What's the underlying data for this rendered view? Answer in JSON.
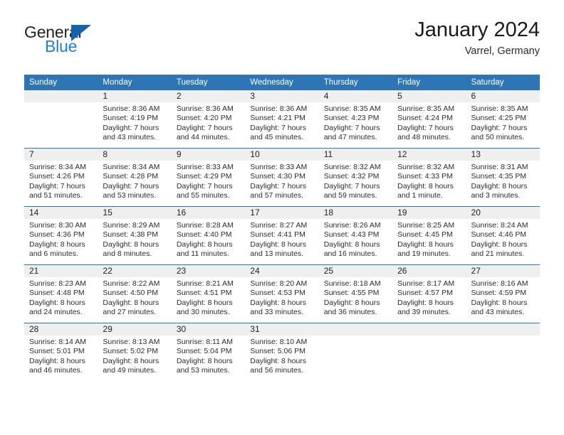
{
  "logo": {
    "word_top": "General",
    "word_bottom": "Blue",
    "triangle_icon": "triangle-icon",
    "color_dark": "#231f20",
    "color_blue": "#1f7fd4"
  },
  "header": {
    "title": "January 2024",
    "subtitle": "Varrel, Germany"
  },
  "theme": {
    "header_bg": "#2e75b6",
    "header_text": "#ffffff",
    "daynum_band_bg": "#efeff0",
    "row_rule": "#2e75b6"
  },
  "calendar": {
    "weekdays": [
      "Sunday",
      "Monday",
      "Tuesday",
      "Wednesday",
      "Thursday",
      "Friday",
      "Saturday"
    ],
    "weeks": [
      [
        {
          "day": "",
          "sunrise": "",
          "sunset": "",
          "daylight1": "",
          "daylight2": ""
        },
        {
          "day": "1",
          "sunrise": "Sunrise: 8:36 AM",
          "sunset": "Sunset: 4:19 PM",
          "daylight1": "Daylight: 7 hours",
          "daylight2": "and 43 minutes."
        },
        {
          "day": "2",
          "sunrise": "Sunrise: 8:36 AM",
          "sunset": "Sunset: 4:20 PM",
          "daylight1": "Daylight: 7 hours",
          "daylight2": "and 44 minutes."
        },
        {
          "day": "3",
          "sunrise": "Sunrise: 8:36 AM",
          "sunset": "Sunset: 4:21 PM",
          "daylight1": "Daylight: 7 hours",
          "daylight2": "and 45 minutes."
        },
        {
          "day": "4",
          "sunrise": "Sunrise: 8:35 AM",
          "sunset": "Sunset: 4:23 PM",
          "daylight1": "Daylight: 7 hours",
          "daylight2": "and 47 minutes."
        },
        {
          "day": "5",
          "sunrise": "Sunrise: 8:35 AM",
          "sunset": "Sunset: 4:24 PM",
          "daylight1": "Daylight: 7 hours",
          "daylight2": "and 48 minutes."
        },
        {
          "day": "6",
          "sunrise": "Sunrise: 8:35 AM",
          "sunset": "Sunset: 4:25 PM",
          "daylight1": "Daylight: 7 hours",
          "daylight2": "and 50 minutes."
        }
      ],
      [
        {
          "day": "7",
          "sunrise": "Sunrise: 8:34 AM",
          "sunset": "Sunset: 4:26 PM",
          "daylight1": "Daylight: 7 hours",
          "daylight2": "and 51 minutes."
        },
        {
          "day": "8",
          "sunrise": "Sunrise: 8:34 AM",
          "sunset": "Sunset: 4:28 PM",
          "daylight1": "Daylight: 7 hours",
          "daylight2": "and 53 minutes."
        },
        {
          "day": "9",
          "sunrise": "Sunrise: 8:33 AM",
          "sunset": "Sunset: 4:29 PM",
          "daylight1": "Daylight: 7 hours",
          "daylight2": "and 55 minutes."
        },
        {
          "day": "10",
          "sunrise": "Sunrise: 8:33 AM",
          "sunset": "Sunset: 4:30 PM",
          "daylight1": "Daylight: 7 hours",
          "daylight2": "and 57 minutes."
        },
        {
          "day": "11",
          "sunrise": "Sunrise: 8:32 AM",
          "sunset": "Sunset: 4:32 PM",
          "daylight1": "Daylight: 7 hours",
          "daylight2": "and 59 minutes."
        },
        {
          "day": "12",
          "sunrise": "Sunrise: 8:32 AM",
          "sunset": "Sunset: 4:33 PM",
          "daylight1": "Daylight: 8 hours",
          "daylight2": "and 1 minute."
        },
        {
          "day": "13",
          "sunrise": "Sunrise: 8:31 AM",
          "sunset": "Sunset: 4:35 PM",
          "daylight1": "Daylight: 8 hours",
          "daylight2": "and 3 minutes."
        }
      ],
      [
        {
          "day": "14",
          "sunrise": "Sunrise: 8:30 AM",
          "sunset": "Sunset: 4:36 PM",
          "daylight1": "Daylight: 8 hours",
          "daylight2": "and 6 minutes."
        },
        {
          "day": "15",
          "sunrise": "Sunrise: 8:29 AM",
          "sunset": "Sunset: 4:38 PM",
          "daylight1": "Daylight: 8 hours",
          "daylight2": "and 8 minutes."
        },
        {
          "day": "16",
          "sunrise": "Sunrise: 8:28 AM",
          "sunset": "Sunset: 4:40 PM",
          "daylight1": "Daylight: 8 hours",
          "daylight2": "and 11 minutes."
        },
        {
          "day": "17",
          "sunrise": "Sunrise: 8:27 AM",
          "sunset": "Sunset: 4:41 PM",
          "daylight1": "Daylight: 8 hours",
          "daylight2": "and 13 minutes."
        },
        {
          "day": "18",
          "sunrise": "Sunrise: 8:26 AM",
          "sunset": "Sunset: 4:43 PM",
          "daylight1": "Daylight: 8 hours",
          "daylight2": "and 16 minutes."
        },
        {
          "day": "19",
          "sunrise": "Sunrise: 8:25 AM",
          "sunset": "Sunset: 4:45 PM",
          "daylight1": "Daylight: 8 hours",
          "daylight2": "and 19 minutes."
        },
        {
          "day": "20",
          "sunrise": "Sunrise: 8:24 AM",
          "sunset": "Sunset: 4:46 PM",
          "daylight1": "Daylight: 8 hours",
          "daylight2": "and 21 minutes."
        }
      ],
      [
        {
          "day": "21",
          "sunrise": "Sunrise: 8:23 AM",
          "sunset": "Sunset: 4:48 PM",
          "daylight1": "Daylight: 8 hours",
          "daylight2": "and 24 minutes."
        },
        {
          "day": "22",
          "sunrise": "Sunrise: 8:22 AM",
          "sunset": "Sunset: 4:50 PM",
          "daylight1": "Daylight: 8 hours",
          "daylight2": "and 27 minutes."
        },
        {
          "day": "23",
          "sunrise": "Sunrise: 8:21 AM",
          "sunset": "Sunset: 4:51 PM",
          "daylight1": "Daylight: 8 hours",
          "daylight2": "and 30 minutes."
        },
        {
          "day": "24",
          "sunrise": "Sunrise: 8:20 AM",
          "sunset": "Sunset: 4:53 PM",
          "daylight1": "Daylight: 8 hours",
          "daylight2": "and 33 minutes."
        },
        {
          "day": "25",
          "sunrise": "Sunrise: 8:18 AM",
          "sunset": "Sunset: 4:55 PM",
          "daylight1": "Daylight: 8 hours",
          "daylight2": "and 36 minutes."
        },
        {
          "day": "26",
          "sunrise": "Sunrise: 8:17 AM",
          "sunset": "Sunset: 4:57 PM",
          "daylight1": "Daylight: 8 hours",
          "daylight2": "and 39 minutes."
        },
        {
          "day": "27",
          "sunrise": "Sunrise: 8:16 AM",
          "sunset": "Sunset: 4:59 PM",
          "daylight1": "Daylight: 8 hours",
          "daylight2": "and 43 minutes."
        }
      ],
      [
        {
          "day": "28",
          "sunrise": "Sunrise: 8:14 AM",
          "sunset": "Sunset: 5:01 PM",
          "daylight1": "Daylight: 8 hours",
          "daylight2": "and 46 minutes."
        },
        {
          "day": "29",
          "sunrise": "Sunrise: 8:13 AM",
          "sunset": "Sunset: 5:02 PM",
          "daylight1": "Daylight: 8 hours",
          "daylight2": "and 49 minutes."
        },
        {
          "day": "30",
          "sunrise": "Sunrise: 8:11 AM",
          "sunset": "Sunset: 5:04 PM",
          "daylight1": "Daylight: 8 hours",
          "daylight2": "and 53 minutes."
        },
        {
          "day": "31",
          "sunrise": "Sunrise: 8:10 AM",
          "sunset": "Sunset: 5:06 PM",
          "daylight1": "Daylight: 8 hours",
          "daylight2": "and 56 minutes."
        },
        {
          "day": "",
          "sunrise": "",
          "sunset": "",
          "daylight1": "",
          "daylight2": ""
        },
        {
          "day": "",
          "sunrise": "",
          "sunset": "",
          "daylight1": "",
          "daylight2": ""
        },
        {
          "day": "",
          "sunrise": "",
          "sunset": "",
          "daylight1": "",
          "daylight2": ""
        }
      ]
    ]
  }
}
